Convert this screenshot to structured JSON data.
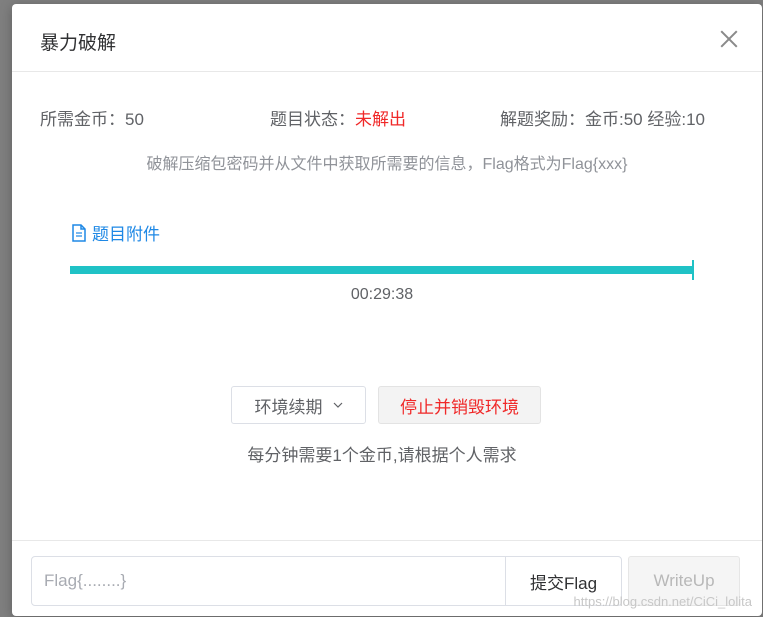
{
  "dialog": {
    "title": "暴力破解"
  },
  "info": {
    "cost_label": "所需金币：",
    "cost_value": "50",
    "status_label": "题目状态：",
    "status_value": "未解出",
    "reward_label": "解题奖励：",
    "reward_value": "金币:50 经验:10"
  },
  "description": "破解压缩包密码并从文件中获取所需要的信息，Flag格式为Flag{xxx}",
  "attachment": {
    "label": "题目附件",
    "icon": "document-icon"
  },
  "progress": {
    "fraction": 1.0,
    "timer": "00:29:38",
    "color": "#1fc2c6"
  },
  "actions": {
    "renew_label": "环境续期",
    "stop_label": "停止并销毁环境",
    "note": "每分钟需要1个金币,请根据个人需求"
  },
  "footer": {
    "flag_placeholder": "Flag{........}",
    "submit_label": "提交Flag",
    "writeup_label": "WriteUp"
  },
  "watermark": "https://blog.csdn.net/CiCi_lolita",
  "colors": {
    "status_red": "#f02828",
    "link_blue": "#1e88e5",
    "accent_teal": "#1fc2c6"
  }
}
